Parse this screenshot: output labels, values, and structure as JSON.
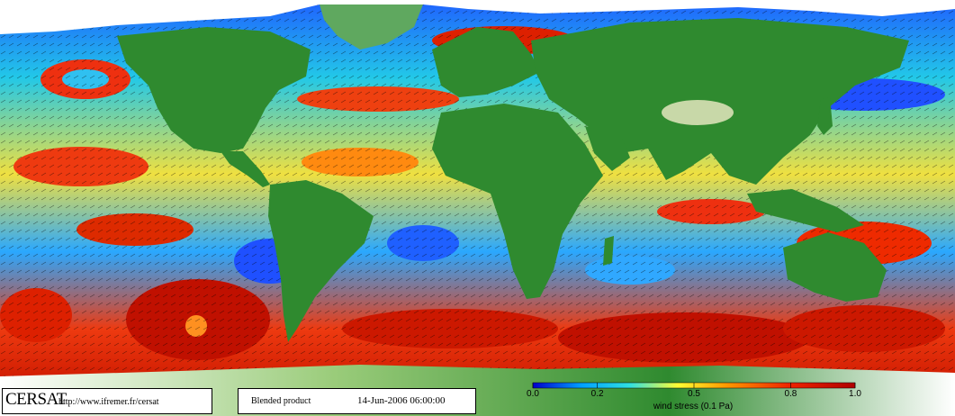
{
  "footer": {
    "brand": "CERSAT",
    "url": "http://www.ifremer.fr/cersat",
    "product": "Blended product",
    "datetime": "14-Jun-2006 06:00:00"
  },
  "legend": {
    "title": "wind stress (0.1 Pa)",
    "ticks": [
      "0.0",
      "0.2",
      "0.5",
      "0.8",
      "1.0"
    ],
    "tick_values": [
      0.0,
      0.2,
      0.5,
      0.8,
      1.0
    ],
    "colors": [
      "#0000cc",
      "#00a0ff",
      "#30e0e0",
      "#ffff33",
      "#ff9900",
      "#ee2200",
      "#b00000"
    ]
  },
  "colors": {
    "land": "#2f8a2f",
    "land_high": "#c8d8a8",
    "ice": "#ffffff",
    "ocean_low": "#0044ee",
    "ocean_mid": "#ffee33",
    "ocean_high": "#dd2200"
  }
}
